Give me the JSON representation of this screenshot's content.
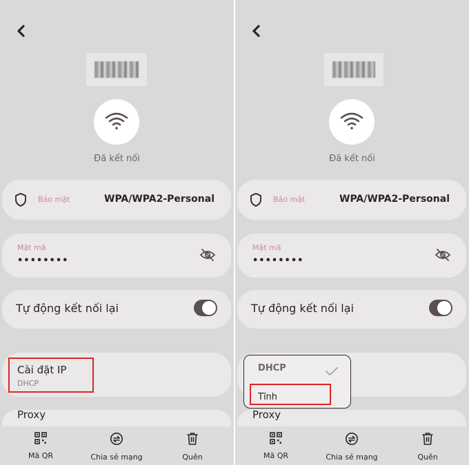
{
  "network": {
    "status": "Đã kết nối",
    "security_label": "Bảo mật",
    "security_value": "WPA/WPA2-Personal",
    "password_label": "Mật mã",
    "password_value": "••••••••",
    "auto_reconnect_label": "Tự động kết nối lại",
    "auto_reconnect_on": true,
    "ip_settings_label": "Cài đặt IP",
    "ip_settings_value": "DHCP",
    "proxy_label": "Proxy"
  },
  "dropdown": {
    "options": [
      "DHCP",
      "Tĩnh"
    ],
    "selected": "DHCP"
  },
  "navbar": {
    "qr_label": "Mã QR",
    "share_label": "Chia sẻ mạng",
    "forget_label": "Quên"
  },
  "colors": {
    "background": "#d9d9d9",
    "card": "#eae8e8",
    "accent_label": "#d08a95",
    "toggle_on": "#5a5052",
    "highlight": "#e02424"
  }
}
